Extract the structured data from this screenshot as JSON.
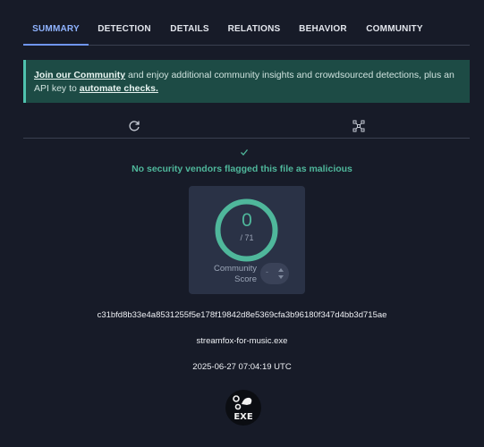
{
  "tabs": [
    {
      "label": "SUMMARY",
      "active": true
    },
    {
      "label": "DETECTION",
      "active": false
    },
    {
      "label": "DETAILS",
      "active": false
    },
    {
      "label": "RELATIONS",
      "active": false
    },
    {
      "label": "BEHAVIOR",
      "active": false
    },
    {
      "label": "COMMUNITY",
      "active": false
    }
  ],
  "banner": {
    "link1": "Join our Community",
    "text1": " and enjoy additional community insights and crowdsourced detections, plus an API key to ",
    "link2": "automate checks."
  },
  "toolbar": {
    "reanalyze_icon": "refresh-icon",
    "similar_icon": "graph-icon"
  },
  "verdict": {
    "icon": "check-icon",
    "text": "No security vendors flagged this file as malicious"
  },
  "score": {
    "value": "0",
    "total": "/ 71",
    "fraction": 0,
    "community_label": "Community Score",
    "community_value": "-"
  },
  "file": {
    "hash": "c31bfd8b33e4a8531255f5e178f19842d8e5369cfa3b96180f347d4bb3d715ae",
    "name": "streamfox-for-music.exe",
    "date": "2025-06-27 07:04:19 UTC",
    "type_icon": "exe-file-icon",
    "type_label": "EXE"
  },
  "colors": {
    "accent": "#6f95f0",
    "clean": "#4fb79b",
    "banner_bg": "#1d4b45",
    "background": "#171b28"
  }
}
